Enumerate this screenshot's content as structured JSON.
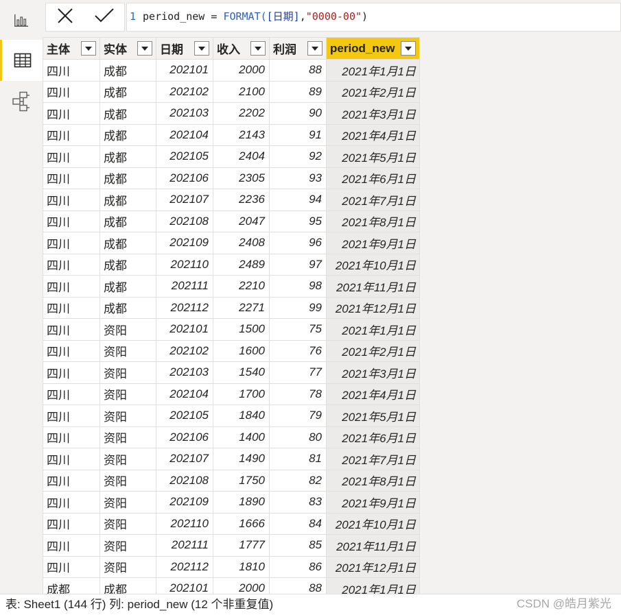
{
  "sidebar": {
    "items": [
      {
        "icon": "report-view-icon",
        "active": false
      },
      {
        "icon": "data-view-icon",
        "active": true
      },
      {
        "icon": "model-view-icon",
        "active": false
      }
    ]
  },
  "formula": {
    "line_number": "1",
    "name": "period_new = ",
    "func": "FORMAT(",
    "column": "[日期]",
    "sep": ",",
    "string": "\"0000-00\"",
    "close": ")"
  },
  "table": {
    "columns": [
      "主体",
      "实体",
      "日期",
      "收入",
      "利润",
      "period_new"
    ],
    "selected_column": "period_new",
    "rows": [
      [
        "四川",
        "成都",
        "202101",
        "2000",
        "88",
        "2021年1月1日"
      ],
      [
        "四川",
        "成都",
        "202102",
        "2100",
        "89",
        "2021年2月1日"
      ],
      [
        "四川",
        "成都",
        "202103",
        "2202",
        "90",
        "2021年3月1日"
      ],
      [
        "四川",
        "成都",
        "202104",
        "2143",
        "91",
        "2021年4月1日"
      ],
      [
        "四川",
        "成都",
        "202105",
        "2404",
        "92",
        "2021年5月1日"
      ],
      [
        "四川",
        "成都",
        "202106",
        "2305",
        "93",
        "2021年6月1日"
      ],
      [
        "四川",
        "成都",
        "202107",
        "2236",
        "94",
        "2021年7月1日"
      ],
      [
        "四川",
        "成都",
        "202108",
        "2047",
        "95",
        "2021年8月1日"
      ],
      [
        "四川",
        "成都",
        "202109",
        "2408",
        "96",
        "2021年9月1日"
      ],
      [
        "四川",
        "成都",
        "202110",
        "2489",
        "97",
        "2021年10月1日"
      ],
      [
        "四川",
        "成都",
        "202111",
        "2210",
        "98",
        "2021年11月1日"
      ],
      [
        "四川",
        "成都",
        "202112",
        "2271",
        "99",
        "2021年12月1日"
      ],
      [
        "四川",
        "资阳",
        "202101",
        "1500",
        "75",
        "2021年1月1日"
      ],
      [
        "四川",
        "资阳",
        "202102",
        "1600",
        "76",
        "2021年2月1日"
      ],
      [
        "四川",
        "资阳",
        "202103",
        "1540",
        "77",
        "2021年3月1日"
      ],
      [
        "四川",
        "资阳",
        "202104",
        "1700",
        "78",
        "2021年4月1日"
      ],
      [
        "四川",
        "资阳",
        "202105",
        "1840",
        "79",
        "2021年5月1日"
      ],
      [
        "四川",
        "资阳",
        "202106",
        "1400",
        "80",
        "2021年6月1日"
      ],
      [
        "四川",
        "资阳",
        "202107",
        "1490",
        "81",
        "2021年7月1日"
      ],
      [
        "四川",
        "资阳",
        "202108",
        "1750",
        "82",
        "2021年8月1日"
      ],
      [
        "四川",
        "资阳",
        "202109",
        "1890",
        "83",
        "2021年9月1日"
      ],
      [
        "四川",
        "资阳",
        "202110",
        "1666",
        "84",
        "2021年10月1日"
      ],
      [
        "四川",
        "资阳",
        "202111",
        "1777",
        "85",
        "2021年11月1日"
      ],
      [
        "四川",
        "资阳",
        "202112",
        "1810",
        "86",
        "2021年12月1日"
      ],
      [
        "成都",
        "成都",
        "202101",
        "2000",
        "88",
        "2021年1月1日"
      ]
    ]
  },
  "status": {
    "text": "表: Sheet1 (144 行) 列: period_new (12 个非重复值)"
  },
  "watermark": "CSDN @皓月紫光",
  "colors": {
    "accent": "#f2c811",
    "background": "#f3f2f1",
    "border": "#e1dfdd"
  }
}
